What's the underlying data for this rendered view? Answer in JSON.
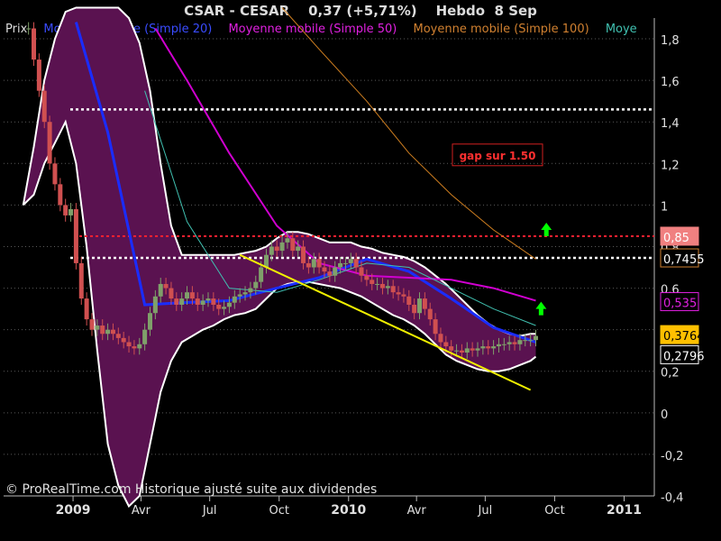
{
  "header": {
    "symbol": "CSAR - CESAR",
    "last": "0,37 (+5,71%)",
    "period": "Hebdo",
    "date": "8 Sep"
  },
  "colors": {
    "background": "#000000",
    "cloud": "#5a1250",
    "band": "#ffffff",
    "candle_up": "#7fa06a",
    "candle_down": "#d05050",
    "ma20": "#1a2cff",
    "ma50": "#d000d0",
    "ma100": "#d07f20",
    "ma_extra": "#40c0b0",
    "trend": "#f0f000",
    "resistance": "#ff2030",
    "support": "#ffffff",
    "arrow": "#00ff00",
    "grid": "#5a5a5a"
  },
  "footer": {
    "watermark": "© ProRealTime.com Historique ajusté suite aux dividendes"
  },
  "annotations": {
    "gap_label": "gap sur 1.50"
  },
  "chart_data": {
    "type": "line",
    "title": "CSAR - CESAR   0,37 (+5,71%)   Hebdo  8 Sep",
    "ylim": [
      -0.4,
      1.9
    ],
    "y_ticks": [
      "1,8",
      "1,6",
      "1,4",
      "1,2",
      "1",
      "0,8",
      "0,6",
      "0,4",
      "0,2",
      "0",
      "-0,2",
      "-0,4"
    ],
    "x_ticks": [
      "2009",
      "Avr",
      "Jul",
      "Oct",
      "2010",
      "Avr",
      "Jul",
      "Oct",
      "2011"
    ],
    "series": [
      {
        "name": "Prix",
        "kind": "candles",
        "x": [
          "2008-11-03",
          "2008-11-10",
          "2008-11-17",
          "2008-11-24",
          "2008-12-01",
          "2008-12-08",
          "2008-12-15",
          "2008-12-22",
          "2008-12-29",
          "2009-01-05",
          "2009-01-12",
          "2009-01-19",
          "2009-01-26",
          "2009-02-02",
          "2009-02-09",
          "2009-02-16",
          "2009-02-23",
          "2009-03-02",
          "2009-03-09",
          "2009-03-16",
          "2009-03-23",
          "2009-03-30",
          "2009-04-06",
          "2009-04-13",
          "2009-04-20",
          "2009-04-27",
          "2009-05-04",
          "2009-05-11",
          "2009-05-18",
          "2009-05-25",
          "2009-06-01",
          "2009-06-08",
          "2009-06-15",
          "2009-06-22",
          "2009-06-29",
          "2009-07-06",
          "2009-07-13",
          "2009-07-20",
          "2009-07-27",
          "2009-08-03",
          "2009-08-10",
          "2009-08-17",
          "2009-08-24",
          "2009-08-31",
          "2009-09-07",
          "2009-09-14",
          "2009-09-21",
          "2009-09-28",
          "2009-10-05",
          "2009-10-12",
          "2009-10-19",
          "2009-10-26",
          "2009-11-02",
          "2009-11-09",
          "2009-11-16",
          "2009-11-23",
          "2009-11-30",
          "2009-12-07",
          "2009-12-14",
          "2009-12-21",
          "2009-12-28",
          "2010-01-04",
          "2010-01-11",
          "2010-01-18",
          "2010-01-25",
          "2010-02-01",
          "2010-02-08",
          "2010-02-15",
          "2010-02-22",
          "2010-03-01",
          "2010-03-08",
          "2010-03-15",
          "2010-03-22",
          "2010-03-29",
          "2010-04-05",
          "2010-04-12",
          "2010-04-19",
          "2010-04-26",
          "2010-05-03",
          "2010-05-10",
          "2010-05-17",
          "2010-05-24",
          "2010-05-31",
          "2010-06-07",
          "2010-06-14",
          "2010-06-21",
          "2010-06-28",
          "2010-07-05",
          "2010-07-12",
          "2010-07-19",
          "2010-07-26",
          "2010-08-02",
          "2010-08-09",
          "2010-08-16",
          "2010-08-23",
          "2010-08-30",
          "2010-09-06"
        ],
        "close": [
          1.85,
          1.7,
          1.55,
          1.4,
          1.2,
          1.1,
          1.0,
          0.95,
          0.98,
          0.72,
          0.55,
          0.45,
          0.4,
          0.42,
          0.38,
          0.4,
          0.38,
          0.36,
          0.34,
          0.32,
          0.31,
          0.33,
          0.4,
          0.48,
          0.56,
          0.62,
          0.6,
          0.55,
          0.52,
          0.55,
          0.58,
          0.55,
          0.52,
          0.54,
          0.55,
          0.52,
          0.5,
          0.51,
          0.53,
          0.56,
          0.57,
          0.58,
          0.6,
          0.63,
          0.7,
          0.76,
          0.8,
          0.78,
          0.82,
          0.84,
          0.78,
          0.8,
          0.72,
          0.7,
          0.74,
          0.7,
          0.68,
          0.66,
          0.7,
          0.72,
          0.72,
          0.74,
          0.7,
          0.66,
          0.64,
          0.62,
          0.62,
          0.6,
          0.61,
          0.58,
          0.57,
          0.56,
          0.52,
          0.48,
          0.55,
          0.5,
          0.45,
          0.38,
          0.34,
          0.32,
          0.3,
          0.3,
          0.29,
          0.31,
          0.3,
          0.31,
          0.32,
          0.31,
          0.32,
          0.33,
          0.33,
          0.34,
          0.33,
          0.35,
          0.35,
          0.35,
          0.37
        ]
      },
      {
        "name": "Moyenne mobile (Simple 20)",
        "kind": "line",
        "x": [
          "2009-01-05",
          "2009-02-16",
          "2009-04-06",
          "2009-05-25",
          "2009-07-27",
          "2009-09-28",
          "2009-11-23",
          "2010-01-25",
          "2010-03-22",
          "2010-05-17",
          "2010-07-12",
          "2010-09-06"
        ],
        "values": [
          1.88,
          1.35,
          0.52,
          0.53,
          0.54,
          0.6,
          0.65,
          0.74,
          0.68,
          0.55,
          0.41,
          0.34
        ]
      },
      {
        "name": "Moyenne mobile (Simple 50)",
        "kind": "line",
        "x": [
          "2009-04-20",
          "2009-06-01",
          "2009-07-27",
          "2009-09-28",
          "2009-11-23",
          "2010-01-25",
          "2010-03-22",
          "2010-05-17",
          "2010-07-12",
          "2010-09-06"
        ],
        "values": [
          1.85,
          1.6,
          1.25,
          0.9,
          0.72,
          0.66,
          0.65,
          0.64,
          0.6,
          0.54
        ]
      },
      {
        "name": "Moyenne mobile (Simple 100)",
        "kind": "line",
        "x": [
          "2009-10-05",
          "2009-11-23",
          "2010-01-25",
          "2010-03-22",
          "2010-05-17",
          "2010-07-12",
          "2010-09-06"
        ],
        "values": [
          1.95,
          1.75,
          1.5,
          1.25,
          1.05,
          0.88,
          0.74
        ]
      },
      {
        "name": "Moye",
        "kind": "line",
        "x": [
          "2009-04-06",
          "2009-06-01",
          "2009-07-27",
          "2009-09-28",
          "2009-11-23",
          "2010-01-25",
          "2010-03-22",
          "2010-05-17",
          "2010-07-12",
          "2010-09-06"
        ],
        "values": [
          1.55,
          0.92,
          0.6,
          0.58,
          0.64,
          0.72,
          0.7,
          0.6,
          0.5,
          0.42
        ]
      }
    ],
    "bands": {
      "x": [
        "2008-10-27",
        "2008-11-10",
        "2008-11-24",
        "2008-12-08",
        "2008-12-22",
        "2009-01-05",
        "2009-01-19",
        "2009-02-02",
        "2009-02-16",
        "2009-03-02",
        "2009-03-16",
        "2009-03-30",
        "2009-04-13",
        "2009-04-27",
        "2009-05-11",
        "2009-05-25",
        "2009-06-08",
        "2009-06-22",
        "2009-07-06",
        "2009-07-20",
        "2009-08-03",
        "2009-08-17",
        "2009-08-31",
        "2009-09-14",
        "2009-09-28",
        "2009-10-12",
        "2009-10-26",
        "2009-11-09",
        "2009-11-23",
        "2009-12-07",
        "2009-12-21",
        "2010-01-04",
        "2010-01-18",
        "2010-02-01",
        "2010-02-15",
        "2010-03-01",
        "2010-03-15",
        "2010-03-29",
        "2010-04-12",
        "2010-04-26",
        "2010-05-10",
        "2010-05-24",
        "2010-06-07",
        "2010-06-21",
        "2010-07-05",
        "2010-07-19",
        "2010-08-02",
        "2010-08-16",
        "2010-08-30",
        "2010-09-06"
      ],
      "upper": [
        1.0,
        1.28,
        1.6,
        1.8,
        1.93,
        1.95,
        1.95,
        1.95,
        1.95,
        1.95,
        1.9,
        1.78,
        1.55,
        1.2,
        0.9,
        0.76,
        0.76,
        0.76,
        0.76,
        0.76,
        0.76,
        0.77,
        0.78,
        0.8,
        0.84,
        0.87,
        0.87,
        0.86,
        0.84,
        0.82,
        0.82,
        0.82,
        0.8,
        0.79,
        0.77,
        0.76,
        0.75,
        0.73,
        0.7,
        0.66,
        0.62,
        0.57,
        0.52,
        0.47,
        0.43,
        0.4,
        0.38,
        0.37,
        0.38,
        0.38
      ],
      "lower": [
        1.0,
        1.05,
        1.2,
        1.3,
        1.4,
        1.2,
        0.8,
        0.3,
        -0.15,
        -0.35,
        -0.45,
        -0.4,
        -0.15,
        0.1,
        0.25,
        0.34,
        0.37,
        0.4,
        0.42,
        0.45,
        0.47,
        0.48,
        0.5,
        0.55,
        0.6,
        0.62,
        0.63,
        0.63,
        0.62,
        0.61,
        0.6,
        0.58,
        0.56,
        0.53,
        0.5,
        0.47,
        0.45,
        0.42,
        0.38,
        0.33,
        0.28,
        0.25,
        0.23,
        0.21,
        0.2,
        0.2,
        0.21,
        0.23,
        0.25,
        0.27
      ]
    },
    "trendline": {
      "x": [
        "2009-08-10",
        "2010-08-30"
      ],
      "values": [
        0.76,
        0.11
      ]
    },
    "levels": [
      {
        "label": "0,85",
        "value": 0.85,
        "style": "resistance"
      },
      {
        "label": "0,7455",
        "value": 0.7455,
        "style": "support"
      },
      {
        "label": "",
        "value": 1.46,
        "style": "support"
      }
    ],
    "value_labels": [
      {
        "text": "0,535",
        "value": 0.535
      },
      {
        "text": "0,3764",
        "value": 0.3764
      },
      {
        "text": "0,2796",
        "value": 0.2796
      }
    ],
    "signals": [
      {
        "date": "2010-09-20",
        "value": 0.88,
        "type": "up"
      },
      {
        "date": "2010-09-13",
        "value": 0.5,
        "type": "up"
      }
    ]
  }
}
